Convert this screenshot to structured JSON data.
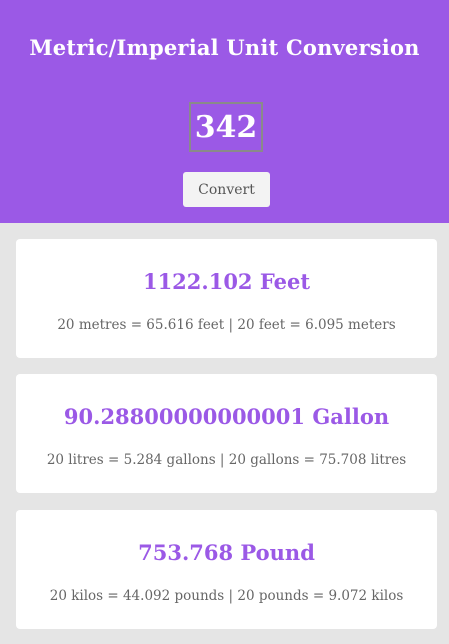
{
  "header": {
    "title": "Metric/Imperial Unit Conversion",
    "input_value": "342",
    "convert_label": "Convert"
  },
  "results": [
    {
      "value": "1122.102 Feet",
      "formula": "20 metres = 65.616 feet | 20 feet = 6.095 meters"
    },
    {
      "value": "90.28800000000001 Gallon",
      "formula": "20 litres = 5.284 gallons | 20 gallons = 75.708 litres"
    },
    {
      "value": "753.768 Pound",
      "formula": "20 kilos = 44.092 pounds | 20 pounds = 9.072 kilos"
    }
  ],
  "colors": {
    "accent": "#9b59e6",
    "background": "#e5e5e5"
  }
}
